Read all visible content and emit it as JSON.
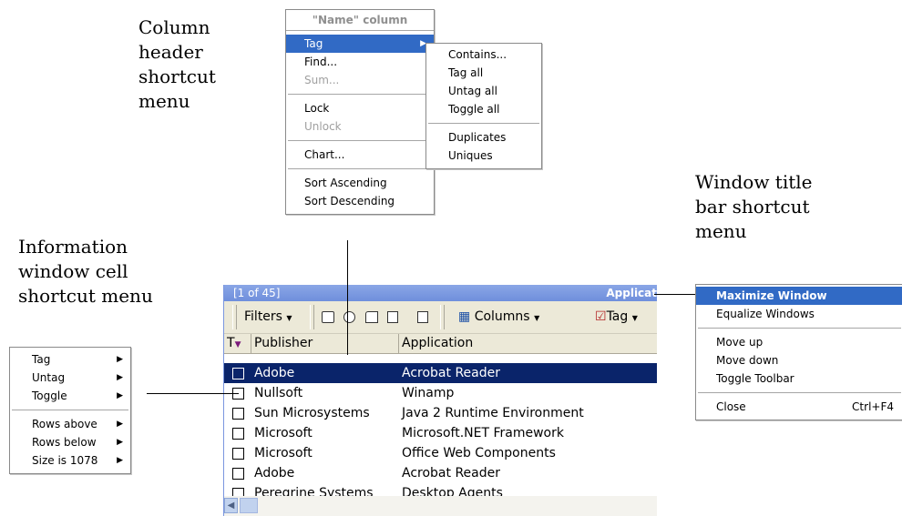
{
  "captions": {
    "column_header": [
      "Column",
      "header",
      "shortcut",
      "menu"
    ],
    "window_title": [
      "Window title",
      "bar shortcut",
      "menu"
    ],
    "info_cell": [
      "Information",
      "window cell",
      "shortcut menu"
    ]
  },
  "column_menu": {
    "title": "\"Name\" column",
    "items": [
      "Tag",
      "Find...",
      "Sum...",
      "Lock",
      "Unlock",
      "Chart...",
      "Sort Ascending",
      "Sort Descending"
    ]
  },
  "tag_submenu": {
    "items": [
      "Contains...",
      "Tag all",
      "Untag all",
      "Toggle all",
      "Duplicates",
      "Uniques"
    ]
  },
  "window_menu": {
    "items": [
      "Maximize Window",
      "Equalize Windows",
      "Move up",
      "Move down",
      "Toggle Toolbar",
      "Close"
    ],
    "close_shortcut": "Ctrl+F4"
  },
  "cell_menu": {
    "items": [
      "Tag",
      "Untag",
      "Toggle",
      "Rows above",
      "Rows below",
      "Size is 1078"
    ]
  },
  "info_window": {
    "title_left": "[1 of 45]",
    "title_right": "Applicat",
    "toolbar": {
      "filters": "Filters",
      "columns": "Columns",
      "tag": "Tag"
    },
    "columns": [
      "T",
      "Publisher",
      "Application"
    ],
    "rows": [
      {
        "publisher": "Adobe",
        "application": "Acrobat Reader"
      },
      {
        "publisher": "Nullsoft",
        "application": "Winamp"
      },
      {
        "publisher": "Sun Microsystems",
        "application": "Java 2 Runtime Environment"
      },
      {
        "publisher": "Microsoft",
        "application": "Microsoft.NET Framework"
      },
      {
        "publisher": "Microsoft",
        "application": "Office Web Components"
      },
      {
        "publisher": "Adobe",
        "application": "Acrobat Reader"
      },
      {
        "publisher": "Peregrine Systems",
        "application": "Desktop Agents"
      }
    ]
  },
  "colors": {
    "selection": "#316ac5",
    "row_selection": "#0a246a",
    "title_bar": "#7b99e0",
    "toolbar": "#ece9d8"
  }
}
